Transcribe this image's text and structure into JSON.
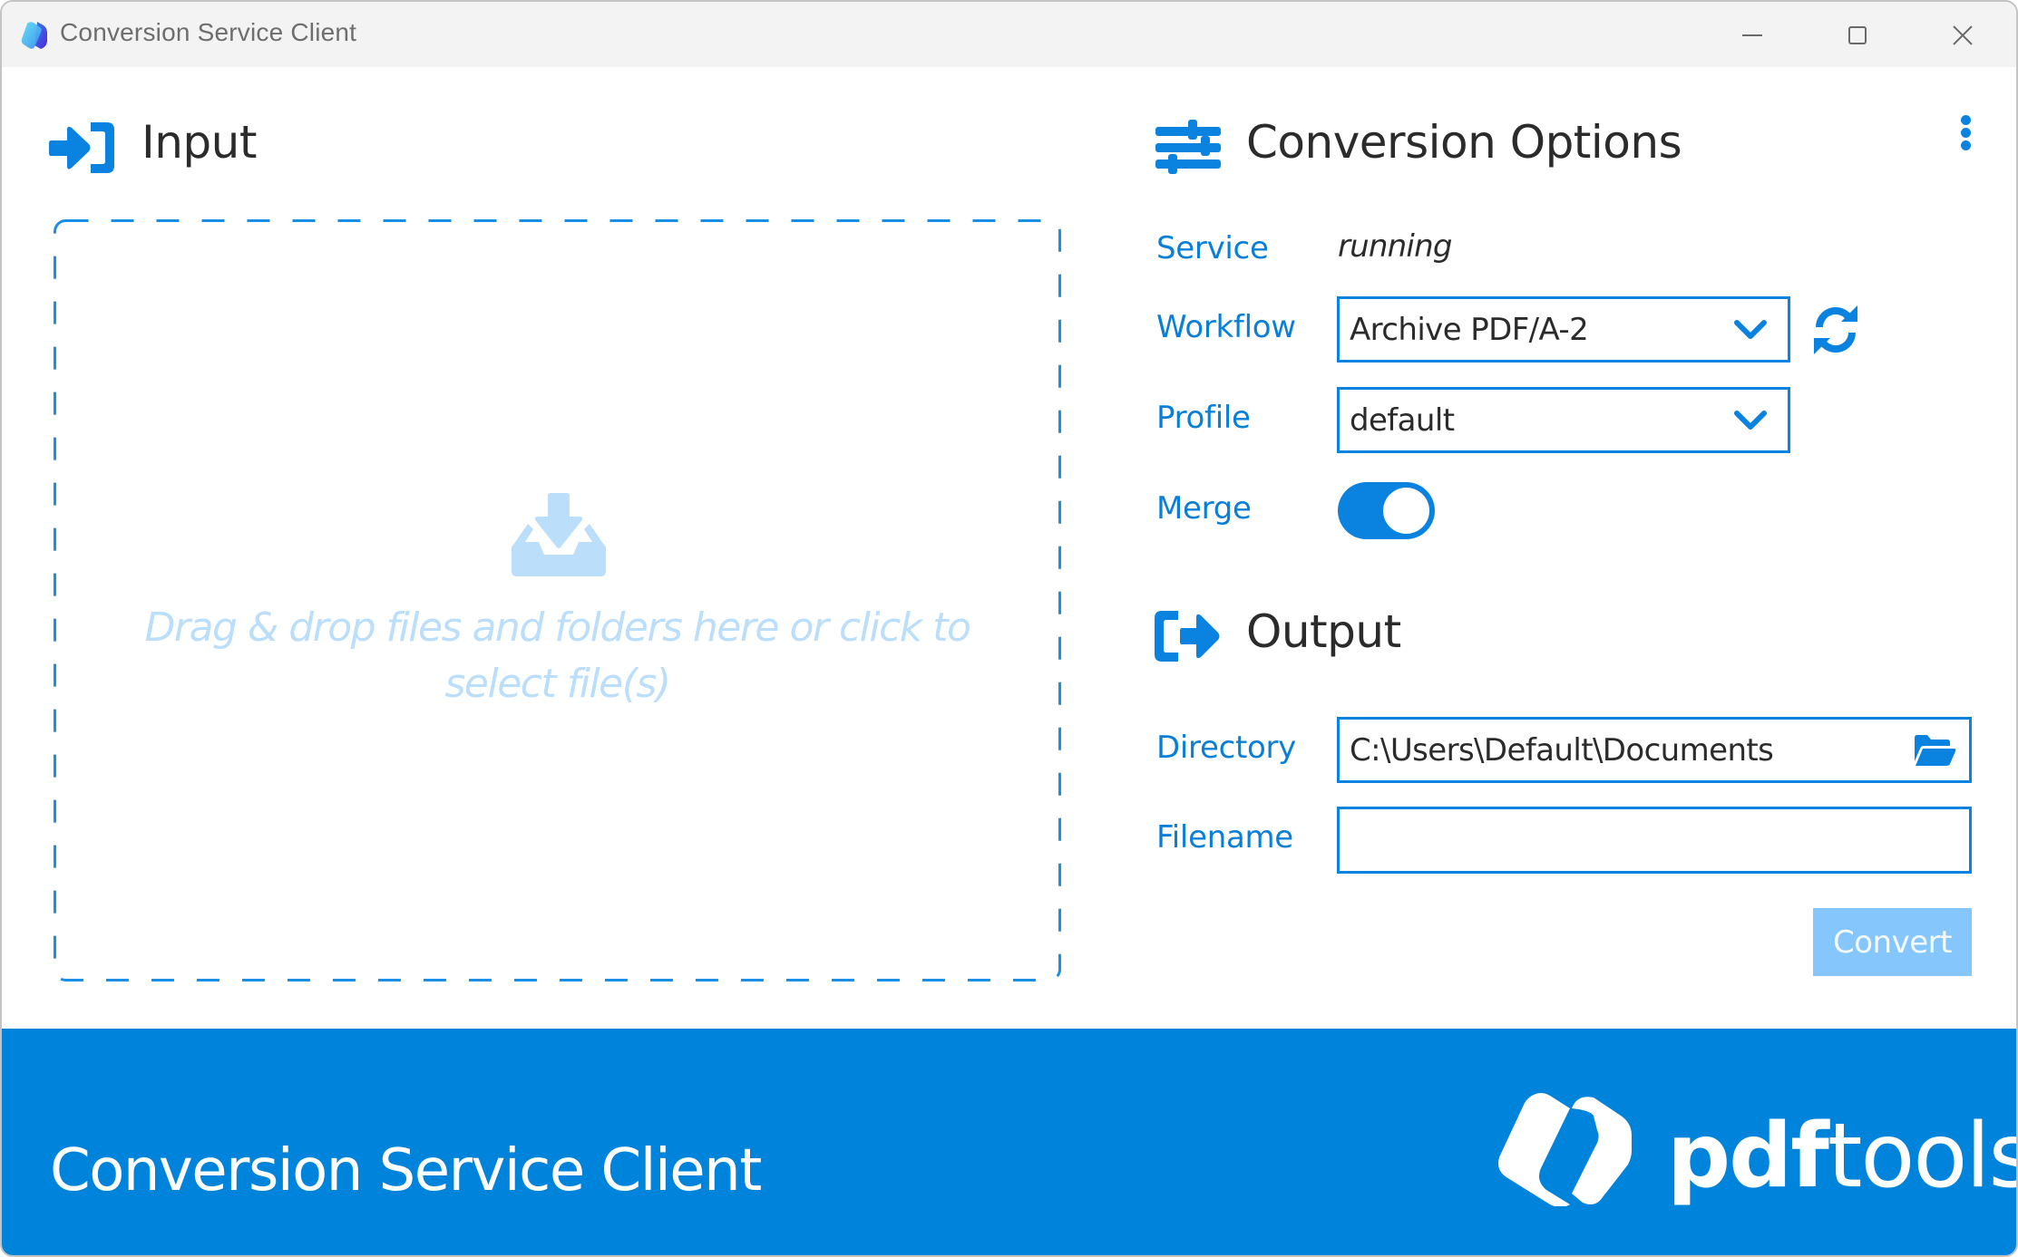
{
  "window": {
    "title": "Conversion Service Client",
    "controls": {
      "minimize": "minimize",
      "maximize": "maximize",
      "close": "close"
    }
  },
  "input": {
    "heading": "Input",
    "icon": "sign-in-icon",
    "dropzone": {
      "icon": "download-tray-icon",
      "text": "Drag & drop files and folders here or click to select file(s)"
    }
  },
  "options": {
    "heading": "Conversion Options",
    "icon": "sliders-icon",
    "menu_icon": "kebab-menu-icon",
    "service": {
      "label": "Service",
      "value": "running"
    },
    "workflow": {
      "label": "Workflow",
      "value": "Archive PDF/A-2",
      "refresh_icon": "refresh-icon"
    },
    "profile": {
      "label": "Profile",
      "value": "default"
    },
    "merge": {
      "label": "Merge",
      "checked": true
    }
  },
  "output": {
    "heading": "Output",
    "icon": "sign-out-icon",
    "directory": {
      "label": "Directory",
      "value": "C:\\Users\\Default\\Documents",
      "browse_icon": "folder-open-icon"
    },
    "filename": {
      "label": "Filename",
      "value": ""
    },
    "convert_label": "Convert"
  },
  "footer": {
    "title": "Conversion Service Client",
    "logo_bold": "pdf",
    "logo_regular": "tools"
  },
  "colors": {
    "accent": "#0a83e0",
    "footer_bg": "#0083db",
    "label": "#0a7fd6",
    "placeholder": "#bbdefb",
    "convert_disabled": "#85c7fc",
    "titlebar_bg": "#f3f3f3"
  }
}
